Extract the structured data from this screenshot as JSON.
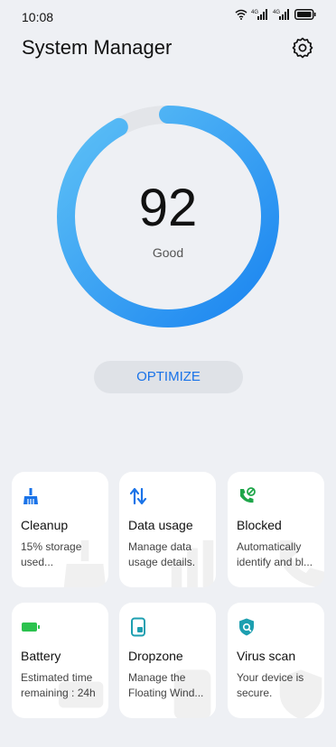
{
  "status": {
    "time": "10:08"
  },
  "header": {
    "title": "System Manager"
  },
  "score": {
    "value": "92",
    "label": "Good",
    "fraction": 0.92
  },
  "optimize": {
    "label": "OPTIMIZE"
  },
  "colors": {
    "accent": "#1a73e8",
    "gauge_start": "#5ec1f6",
    "gauge_end": "#1a84f0",
    "track": "#e3e5e9",
    "battery_green": "#2bc24e",
    "call_green": "#1fa64a",
    "tool_blue": "#1a73e8",
    "dropzone_teal": "#1d9fb0"
  },
  "cards": [
    {
      "title": "Cleanup",
      "desc": "15% storage used...",
      "icon": "broom-icon"
    },
    {
      "title": "Data usage",
      "desc": "Manage data usage details.",
      "icon": "data-arrows-icon"
    },
    {
      "title": "Blocked",
      "desc": "Automatically identify and bl...",
      "icon": "blocked-call-icon"
    },
    {
      "title": "Battery",
      "desc": "Estimated time remaining : 24h",
      "icon": "battery-icon"
    },
    {
      "title": "Dropzone",
      "desc": "Manage the Floating Wind...",
      "icon": "dropzone-icon"
    },
    {
      "title": "Virus scan",
      "desc": "Your device is secure.",
      "icon": "shield-scan-icon"
    }
  ]
}
